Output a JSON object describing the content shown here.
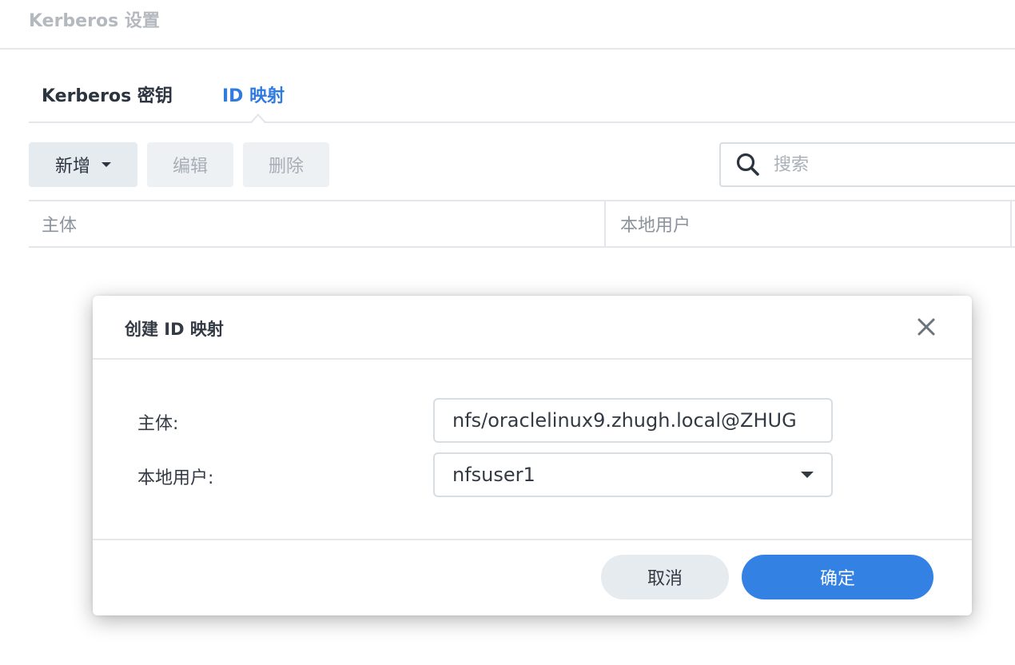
{
  "window": {
    "title": "Kerberos 设置"
  },
  "tabs": [
    {
      "label": "Kerberos 密钥",
      "active": false
    },
    {
      "label": "ID 映射",
      "active": true
    }
  ],
  "toolbar": {
    "add_label": "新增",
    "edit_label": "编辑",
    "delete_label": "删除",
    "search_placeholder": "搜索"
  },
  "table": {
    "columns": [
      "主体",
      "本地用户"
    ]
  },
  "dialog": {
    "title": "创建 ID 映射",
    "fields": {
      "principal_label": "主体:",
      "principal_value": "nfs/oraclelinux9.zhugh.local@ZHUG",
      "local_user_label": "本地用户:",
      "local_user_value": "nfsuser1"
    },
    "cancel_label": "取消",
    "ok_label": "确定"
  },
  "colors": {
    "accent": "#3381e3",
    "active_tab": "#2f7be0",
    "disabled_text": "#a7aeb6"
  },
  "icons": [
    "search-icon",
    "close-icon",
    "chevron-down-icon"
  ]
}
